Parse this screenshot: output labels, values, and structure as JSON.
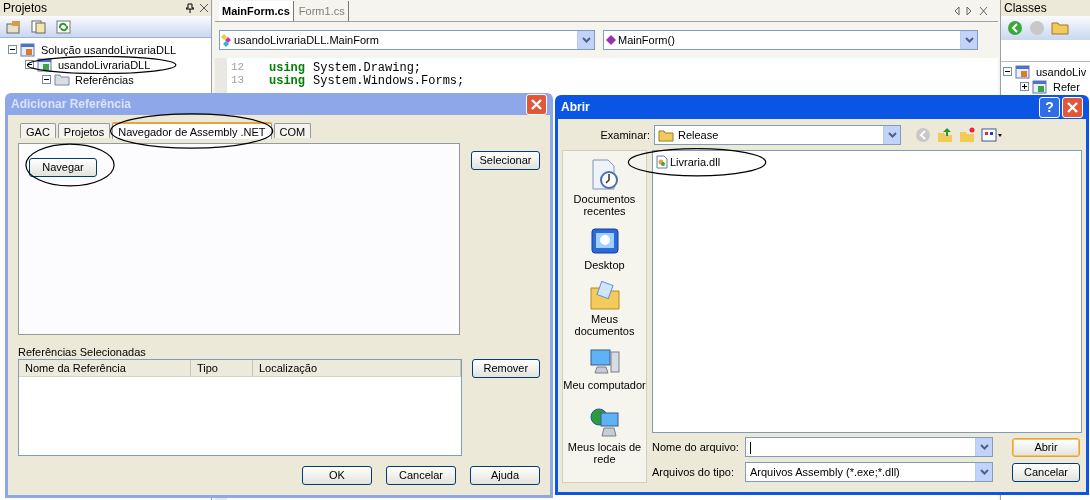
{
  "projects_panel": {
    "title": "Projetos",
    "tree": [
      {
        "label": "Solução usandoLivrariaDLL",
        "expanded": true,
        "circled": false,
        "children": [
          {
            "label": "usandoLivrariaDLL",
            "expanded": true,
            "circled": true,
            "children": [
              {
                "label": "Referências",
                "expanded": true,
                "circled": false
              }
            ]
          }
        ]
      }
    ]
  },
  "editor": {
    "tabs": [
      {
        "label": "MainForm.cs",
        "selected": true
      },
      {
        "label": "Form1.cs",
        "selected": false
      }
    ],
    "type_dropdown": "usandoLivrariaDLL.MainForm",
    "member_dropdown": "MainForm()",
    "lines": [
      {
        "number": "12",
        "keyword": "using",
        "code": "System.Drawing;"
      },
      {
        "number": "13",
        "keyword": "using",
        "code": "System.Windows.Forms;"
      }
    ]
  },
  "classes_panel": {
    "title": "Classes",
    "tree": [
      {
        "label": "usandoLiv",
        "expanded": true,
        "circled": false,
        "children": [
          {
            "label": "Refer",
            "expanded": false,
            "circled": false
          }
        ]
      }
    ]
  },
  "add_reference_dialog": {
    "title": "Adicionar Referência",
    "tabs": [
      {
        "label": "GAC",
        "selected": false,
        "circled": false
      },
      {
        "label": "Projetos",
        "selected": false,
        "circled": false
      },
      {
        "label": "Navegador de Assembly .NET",
        "selected": true,
        "circled": true
      },
      {
        "label": "COM",
        "selected": false,
        "circled": false
      }
    ],
    "browse_button": {
      "label": "Navegar",
      "circled": true
    },
    "select_button": "Selecionar",
    "selected_label": "Referências Selecionadas",
    "columns": [
      "Nome da Referência",
      "Tipo",
      "Localização"
    ],
    "remove_button": "Remover",
    "buttons": [
      "OK",
      "Cancelar",
      "Ajuda"
    ]
  },
  "open_dialog": {
    "title": "Abrir",
    "help_button": "?",
    "look_in_label": "Examinar:",
    "look_in_value": "Release",
    "places": [
      {
        "kind": "recent",
        "label": "Documentos recentes"
      },
      {
        "kind": "desktop",
        "label": "Desktop"
      },
      {
        "kind": "documents",
        "label": "Meus documentos"
      },
      {
        "kind": "computer",
        "label": "Meu computador"
      },
      {
        "kind": "network",
        "label": "Meus locais de rede"
      }
    ],
    "files": [
      {
        "name": "Livraria.dll",
        "circled": true
      }
    ],
    "filename_label": "Nome do arquivo:",
    "filetype_label": "Arquivos do tipo:",
    "filetype_value": "Arquivos Assembly (*.exe;*.dll)",
    "open_button": "Abrir",
    "cancel_button": "Cancelar"
  }
}
